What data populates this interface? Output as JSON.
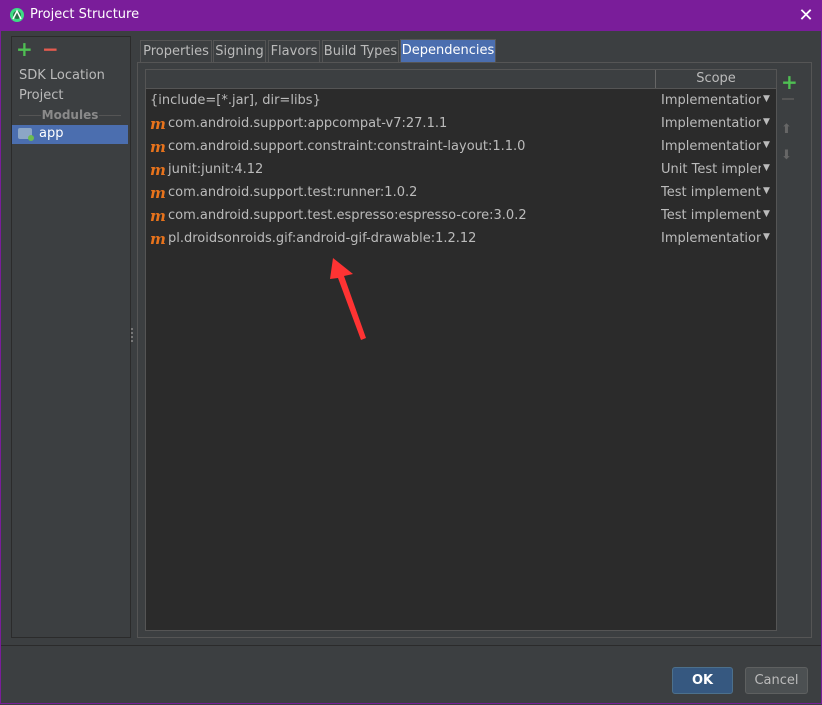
{
  "window": {
    "title": "Project Structure",
    "close_label": "✕"
  },
  "left_toolbar": {
    "add": "+",
    "remove": "−"
  },
  "nav": {
    "items": [
      {
        "label": "SDK Location"
      },
      {
        "label": "Project"
      }
    ],
    "modules_header": "Modules",
    "modules": [
      {
        "label": "app"
      }
    ]
  },
  "tabs": [
    {
      "label": "Properties"
    },
    {
      "label": "Signing"
    },
    {
      "label": "Flavors"
    },
    {
      "label": "Build Types"
    },
    {
      "label": "Dependencies",
      "selected": true
    }
  ],
  "table": {
    "scope_header": "Scope",
    "rows": [
      {
        "icon": "",
        "name": "{include=[*.jar], dir=libs}",
        "scope": "Implementation"
      },
      {
        "icon": "m",
        "name": "com.android.support:appcompat-v7:27.1.1",
        "scope": "Implementation"
      },
      {
        "icon": "m",
        "name": "com.android.support.constraint:constraint-layout:1.1.0",
        "scope": "Implementation"
      },
      {
        "icon": "m",
        "name": "junit:junit:4.12",
        "scope": "Unit Test implem..."
      },
      {
        "icon": "m",
        "name": "com.android.support.test:runner:1.0.2",
        "scope": "Test implementat..."
      },
      {
        "icon": "m",
        "name": "com.android.support.test.espresso:espresso-core:3.0.2",
        "scope": "Test implementat..."
      },
      {
        "icon": "m",
        "name": "pl.droidsonroids.gif:android-gif-drawable:1.2.12",
        "scope": "Implementation"
      }
    ]
  },
  "side_tools": {
    "add": "+",
    "up": "⬆",
    "down": "⬇"
  },
  "buttons": {
    "ok": "OK",
    "cancel": "Cancel"
  },
  "colors": {
    "title_bar": "#7a1d9a",
    "selected": "#4b6eaf",
    "maven_icon": "#e8731c",
    "add_green": "#4fbf53",
    "remove_red": "#e45b4f",
    "annotation_arrow": "#ff3333"
  }
}
